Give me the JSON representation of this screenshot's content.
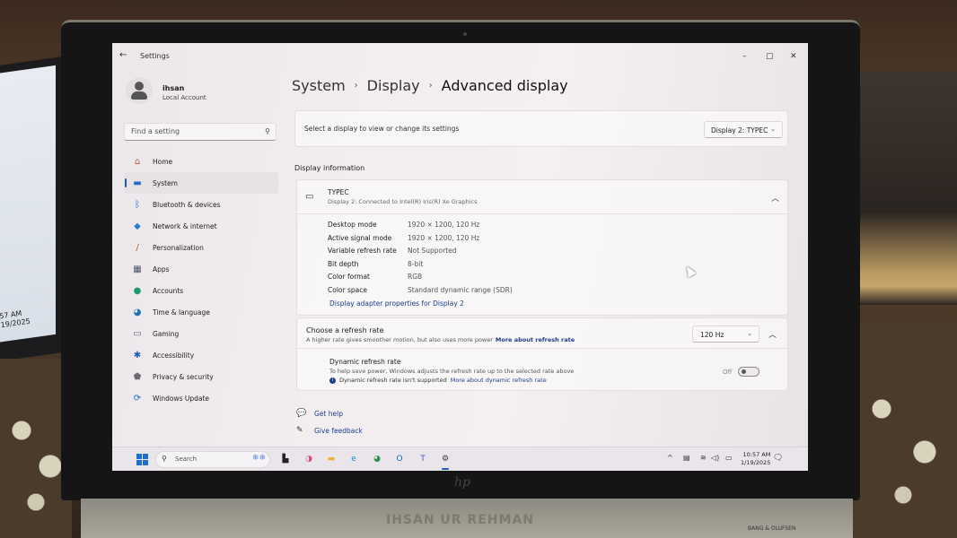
{
  "window": {
    "title": "Settings",
    "controls": {
      "minimize": "–",
      "maximize": "▢",
      "close": "✕"
    }
  },
  "user": {
    "name": "ihsan",
    "account_type": "Local Account"
  },
  "search": {
    "placeholder": "Find a setting"
  },
  "sidebar": {
    "items": [
      {
        "label": "Home",
        "icon": "home-icon",
        "glyph": "⌂",
        "color": "#c05a2a"
      },
      {
        "label": "System",
        "icon": "system-icon",
        "glyph": "▬",
        "color": "#1a6fc9",
        "active": true
      },
      {
        "label": "Bluetooth & devices",
        "icon": "bluetooth-icon",
        "glyph": "ᛒ",
        "color": "#1a6fc9"
      },
      {
        "label": "Network & internet",
        "icon": "network-icon",
        "glyph": "◆",
        "color": "#2a7fd4"
      },
      {
        "label": "Personalization",
        "icon": "brush-icon",
        "glyph": "/",
        "color": "#c0561e"
      },
      {
        "label": "Apps",
        "icon": "apps-icon",
        "glyph": "▦",
        "color": "#4a5468"
      },
      {
        "label": "Accounts",
        "icon": "accounts-icon",
        "glyph": "●",
        "color": "#1e9a6a"
      },
      {
        "label": "Time & language",
        "icon": "globe-clock-icon",
        "glyph": "◕",
        "color": "#1d72b8"
      },
      {
        "label": "Gaming",
        "icon": "gamepad-icon",
        "glyph": "▭",
        "color": "#6a6a72"
      },
      {
        "label": "Accessibility",
        "icon": "accessibility-icon",
        "glyph": "✱",
        "color": "#1a5fb4"
      },
      {
        "label": "Privacy & security",
        "icon": "shield-icon",
        "glyph": "⬟",
        "color": "#6a6a70"
      },
      {
        "label": "Windows Update",
        "icon": "update-icon",
        "glyph": "⟳",
        "color": "#1a6fc9"
      }
    ]
  },
  "breadcrumb": {
    "items": [
      "System",
      "Display"
    ],
    "current": "Advanced display",
    "separator": "›"
  },
  "display_select": {
    "label": "Select a display to view or change its settings",
    "value": "Display 2: TYPEC"
  },
  "display_info": {
    "section_title": "Display information",
    "name": "TYPEC",
    "subtitle": "Display 2: Connected to Intel(R) Iris(R) Xe Graphics",
    "rows": [
      {
        "key": "Desktop mode",
        "value": "1920 × 1200, 120 Hz"
      },
      {
        "key": "Active signal mode",
        "value": "1920 × 1200, 120 Hz"
      },
      {
        "key": "Variable refresh rate",
        "value": "Not Supported"
      },
      {
        "key": "Bit depth",
        "value": "8-bit"
      },
      {
        "key": "Color format",
        "value": "RGB"
      },
      {
        "key": "Color space",
        "value": "Standard dynamic range (SDR)"
      }
    ],
    "adapter_link": "Display adapter properties for Display 2"
  },
  "refresh_rate": {
    "title": "Choose a refresh rate",
    "description": "A higher rate gives smoother motion, but also uses more power",
    "link": "More about refresh rate",
    "value": "120 Hz",
    "dynamic": {
      "title": "Dynamic refresh rate",
      "description": "To help save power, Windows adjusts the refresh rate up to the selected rate above",
      "notice": "Dynamic refresh rate isn't supported",
      "link": "More about dynamic refresh rate",
      "toggle_label": "Off",
      "toggle_on": false
    }
  },
  "help": {
    "get_help": "Get help",
    "give_feedback": "Give feedback"
  },
  "taskbar": {
    "search_placeholder": "Search",
    "apps": [
      {
        "name": "task-view",
        "glyph": "▙",
        "color": "#222"
      },
      {
        "name": "copilot",
        "glyph": "◑",
        "color": "#d6478a"
      },
      {
        "name": "file-explorer",
        "glyph": "▬",
        "color": "#e8b22c"
      },
      {
        "name": "edge",
        "glyph": "e",
        "color": "#1b8fd0"
      },
      {
        "name": "chrome-like",
        "glyph": "◕",
        "color": "#2e8f4a"
      },
      {
        "name": "outlook",
        "glyph": "O",
        "color": "#1267c4"
      },
      {
        "name": "teams",
        "glyph": "T",
        "color": "#5059c9"
      },
      {
        "name": "settings",
        "glyph": "⚙",
        "color": "#3a3a3a",
        "active": true
      }
    ],
    "time": "10:57 AM",
    "date": "1/19/2025"
  },
  "background": {
    "left_monitor_clock": "57 AM\n19/2025",
    "engraving": "IHSAN UR REHMAN",
    "brand_label": "BANG & OLUFSEN",
    "laptop_logo": "hp"
  }
}
